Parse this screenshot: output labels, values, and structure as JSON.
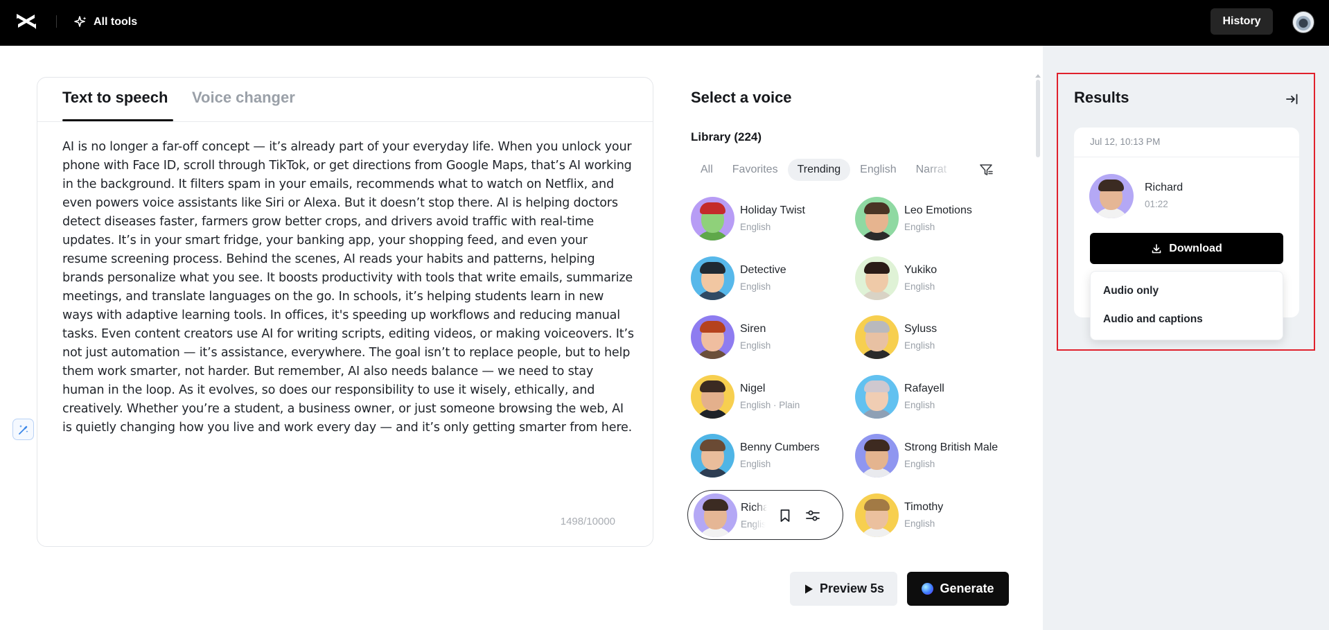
{
  "topbar": {
    "logo_icon": "capcut-logo-icon",
    "all_tools_label": "All tools",
    "all_tools_icon": "sparkle-icon",
    "history_label": "History",
    "avatar_icon": "user-avatar-icon"
  },
  "editor": {
    "tabs": [
      {
        "label": "Text to speech",
        "active": true
      },
      {
        "label": "Voice changer",
        "active": false
      }
    ],
    "text": "AI is no longer a far-off concept — it’s already part of your everyday life. When you unlock your phone with Face ID, scroll through TikTok, or get directions from Google Maps, that’s AI working in the background. It filters spam in your emails, recommends what to watch on Netflix, and even powers voice assistants like Siri or Alexa. But it doesn’t stop there. AI is helping doctors detect diseases faster, farmers grow better crops, and drivers avoid traffic with real-time updates. It’s in your smart fridge, your banking app, your shopping feed, and even your resume screening process. Behind the scenes, AI reads your habits and patterns, helping brands personalize what you see. It boosts productivity with tools that write emails, summarize meetings, and translate languages on the go. In schools, it’s helping students learn in new ways with adaptive learning tools. In offices, it's speeding up workflows and reducing manual tasks. Even content creators use AI for writing scripts, editing videos, or making voiceovers. It’s not just automation — it’s assistance, everywhere. The goal isn’t to replace people, but to help them work smarter, not harder. But remember, AI also needs balance — we need to stay human in the loop. As it evolves, so does our responsibility to use it wisely, ethically, and creatively. Whether you’re a student, a business owner, or just someone browsing the web, AI is quietly changing how you live and work every day — and it’s only getting smarter from here.",
    "char_count": "1498/10000",
    "magic_icon": "magic-wand-icon"
  },
  "voice_panel": {
    "title": "Select a voice",
    "library_label": "Library (224)",
    "filters": [
      "All",
      "Favorites",
      "Trending",
      "English",
      "Narrat"
    ],
    "active_filter": "Trending",
    "filter_icon": "filter-icon",
    "voices": [
      {
        "name": "Holiday Twist",
        "lang": "English",
        "bg": "#b79cf5",
        "skin": "#8fd17a",
        "hair": "#c42b2b",
        "cloth": "#5fa84a"
      },
      {
        "name": "Leo Emotions",
        "lang": "English",
        "bg": "#8fd9a2",
        "skin": "#e6b48f",
        "hair": "#4a3424",
        "cloth": "#2b2b2b"
      },
      {
        "name": "Detective",
        "lang": "English",
        "bg": "#57b8ea",
        "skin": "#f1c7a2",
        "hair": "#1f2a33",
        "cloth": "#2f4a64"
      },
      {
        "name": "Yukiko",
        "lang": "English",
        "bg": "#dff2d6",
        "skin": "#efcaa8",
        "hair": "#2a1c17",
        "cloth": "#d9d3c5"
      },
      {
        "name": "Siren",
        "lang": "English",
        "bg": "#8e7cf0",
        "skin": "#f0bea0",
        "hair": "#b5421d",
        "cloth": "#6b4f3a"
      },
      {
        "name": "Syluss",
        "lang": "English",
        "bg": "#f7cf4f",
        "skin": "#e8c1a3",
        "hair": "#b9b9bd",
        "cloth": "#2b2b2b"
      },
      {
        "name": "Nigel",
        "lang": "English · Plain",
        "bg": "#f7cf4f",
        "skin": "#e4b08c",
        "hair": "#3b2a22",
        "cloth": "#1f2329"
      },
      {
        "name": "Rafayell",
        "lang": "English",
        "bg": "#62c1f0",
        "skin": "#f0cdb3",
        "hair": "#cfc8cf",
        "cloth": "#8ea0b5"
      },
      {
        "name": "Benny Cumbers",
        "lang": "English",
        "bg": "#4fb5e6",
        "skin": "#e9bd9b",
        "hair": "#6a4a34",
        "cloth": "#2d3d52"
      },
      {
        "name": "Strong British Male",
        "lang": "English",
        "bg": "#8f96f0",
        "skin": "#e4b48f",
        "hair": "#3d2a20",
        "cloth": "#e9eaee"
      },
      {
        "name": "Richard",
        "lang": "English",
        "bg": "#b4a8f5",
        "skin": "#e5b695",
        "hair": "#3b2b22",
        "cloth": "#f2f2f2"
      },
      {
        "name": "Timothy",
        "lang": "English",
        "bg": "#f7cf4f",
        "skin": "#ebc09e",
        "hair": "#a27a45",
        "cloth": "#f0f0f0"
      }
    ],
    "selected_icons": [
      "bookmark-icon",
      "sliders-icon"
    ],
    "preview_label": "Preview 5s",
    "generate_label": "Generate"
  },
  "results": {
    "title": "Results",
    "collapse_icon": "collapse-panel-icon",
    "item": {
      "date": "Jul 12, 10:13 PM",
      "name": "Richard",
      "duration": "01:22"
    },
    "download_label": "Download",
    "download_icon": "download-icon",
    "menu": [
      "Audio only",
      "Audio and captions"
    ]
  }
}
